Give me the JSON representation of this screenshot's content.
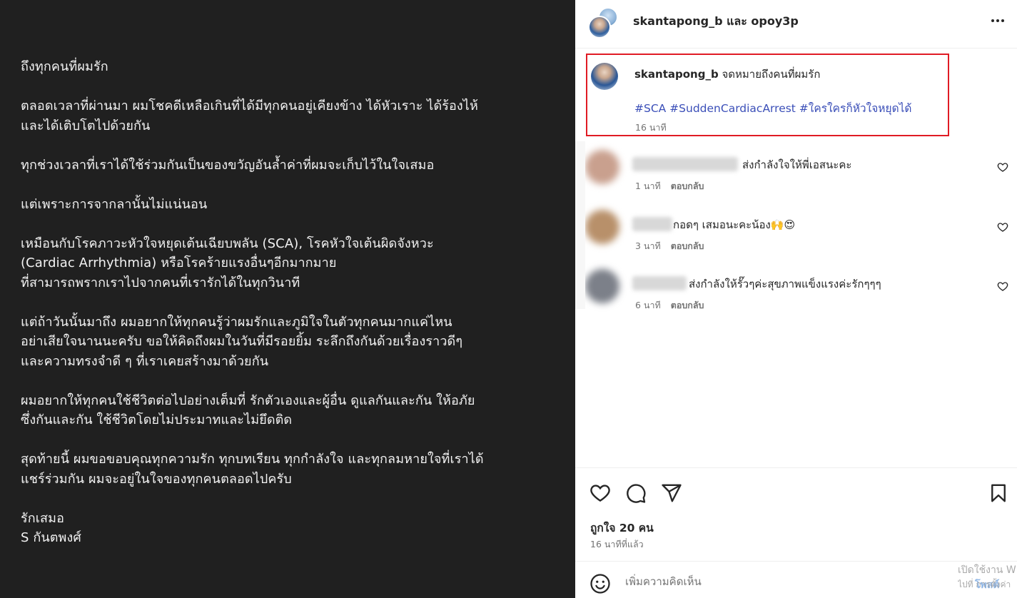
{
  "letter": {
    "paragraphs": [
      [
        "ถึงทุกคนที่ผมรัก"
      ],
      [
        "ตลอดเวลาที่ผ่านมา ผมโชคดีเหลือเกินที่ได้มีทุกคนอยู่เคียงข้าง ได้หัวเราะ ได้ร้องไห้",
        "และได้เติบโตไปด้วยกัน"
      ],
      [
        "ทุกช่วงเวลาที่เราได้ใช้ร่วมกันเป็นของขวัญอันล้ำค่าที่ผมจะเก็บไว้ในใจเสมอ"
      ],
      [
        "แต่เพราะการจากลานั้นไม่แน่นอน"
      ],
      [
        "เหมือนกับโรคภาวะหัวใจหยุดเต้นเฉียบพลัน (SCA), โรคหัวใจเต้นผิดจังหวะ",
        "(Cardiac Arrhythmia) หรือโรคร้ายแรงอื่นๆอีกมากมาย",
        "ที่สามารถพรากเราไปจากคนที่เรารักได้ในทุกวินาที"
      ],
      [
        "แต่ถ้าวันนั้นมาถึง ผมอยากให้ทุกคนรู้ว่าผมรักและภูมิใจในตัวทุกคนมากแค่ไหน",
        "อย่าเสียใจนานนะครับ ขอให้คิดถึงผมในวันที่มีรอยยิ้ม ระลึกถึงกันด้วยเรื่องราวดีๆ",
        "และความทรงจำดี ๆ ที่เราเคยสร้างมาด้วยกัน"
      ],
      [
        "ผมอยากให้ทุกคนใช้ชีวิตต่อไปอย่างเต็มที่ รักตัวเองและผู้อื่น ดูแลกันและกัน ให้อภัย",
        "ซึ่งกันและกัน ใช้ชีวิตโดยไม่ประมาทและไม่ยึดติด"
      ],
      [
        "สุดท้ายนี้ ผมขอขอบคุณทุกความรัก ทุกบทเรียน ทุกกำลังใจ และทุกลมหายใจที่เราได้",
        "แชร์ร่วมกัน ผมจะอยู่ในใจของทุกคนตลอดไปครับ"
      ],
      [
        "รักเสมอ",
        "S กันตพงศ์"
      ]
    ]
  },
  "header": {
    "title": "skantapong_b และ opoy3p"
  },
  "caption": {
    "username": "skantapong_b",
    "text": "จดหมายถึงคนที่ผมรัก",
    "hashtags": "#SCA #SuddenCardiacArrest #ใครใครก็หัวใจหยุดได้",
    "time": "16 นาที"
  },
  "comments": [
    {
      "text": "ส่งกำลังใจให้พี่เอสนะคะ",
      "time": "1 นาที",
      "reply": "ตอบกลับ",
      "avatar_color": "#c9a08e"
    },
    {
      "text": "กอดๆ เสมอนะคะน้อง🙌😍",
      "time": "3 นาที",
      "reply": "ตอบกลับ",
      "avatar_color": "#b8906a"
    },
    {
      "text": "ส่งกำลังให้รั๊วๆค่ะสุขภาพแข็งแรงค่ะรักๆๆๆ",
      "time": "6 นาที",
      "reply": "ตอบกลับ",
      "avatar_color": "#7c8089"
    }
  ],
  "actions": {
    "likes": "ถูกใจ 20 คน",
    "posted": "16 นาทีที่แล้ว"
  },
  "add_comment": {
    "placeholder": "เพิ่มความคิดเห็น",
    "post_label": "โพสต์"
  },
  "watermark": {
    "line1": "เปิดใช้งาน W",
    "line2": "ไปที่ การตั้งค่า"
  }
}
